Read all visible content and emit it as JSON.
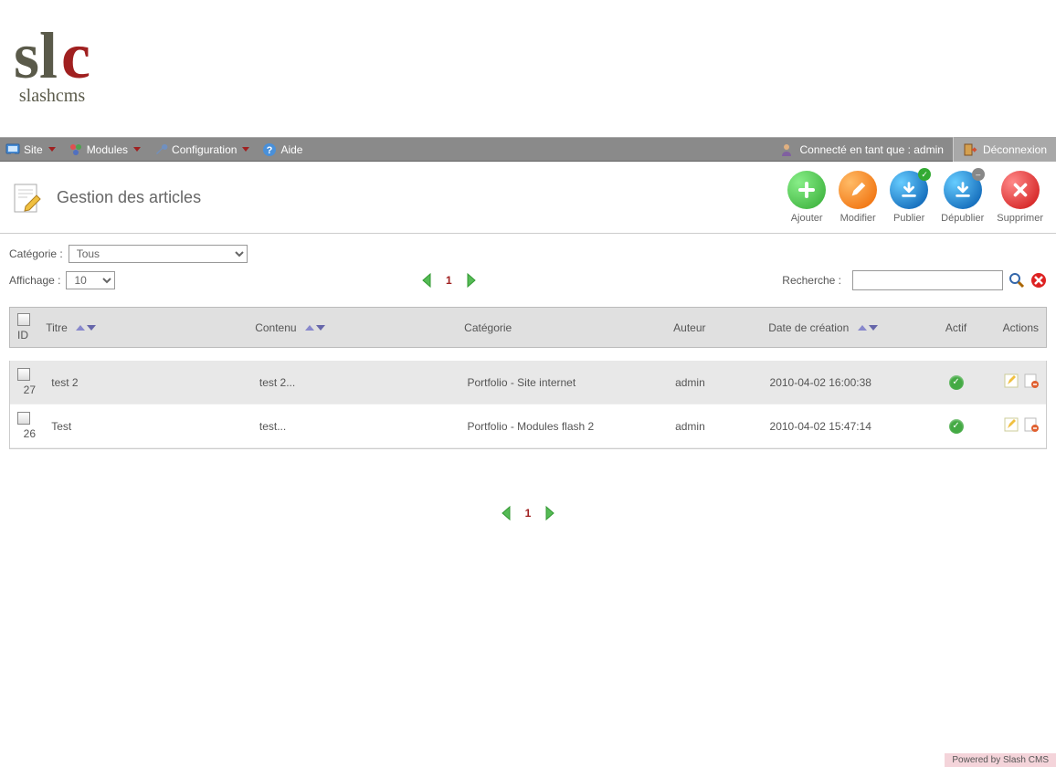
{
  "logo": {
    "subtitle": "slashcms"
  },
  "menu": {
    "site": "Site",
    "modules": "Modules",
    "configuration": "Configuration",
    "aide": "Aide"
  },
  "user": {
    "status_prefix": "Connecté en tant que : ",
    "username": "admin",
    "logout": "Déconnexion"
  },
  "page": {
    "title": "Gestion des articles"
  },
  "actions": {
    "ajouter": "Ajouter",
    "modifier": "Modifier",
    "publier": "Publier",
    "depublier": "Dépublier",
    "supprimer": "Supprimer"
  },
  "filters": {
    "categorie_label": "Catégorie :",
    "categorie_value": "Tous",
    "affichage_label": "Affichage :",
    "affichage_value": "10",
    "recherche_label": "Recherche :"
  },
  "pager": {
    "current": "1"
  },
  "table": {
    "headers": {
      "id": "ID",
      "titre": "Titre",
      "contenu": "Contenu",
      "categorie": "Catégorie",
      "auteur": "Auteur",
      "date": "Date de création",
      "actif": "Actif",
      "actions": "Actions"
    },
    "rows": [
      {
        "id": "27",
        "titre": "test 2",
        "contenu": "test 2...",
        "categorie": "Portfolio - Site internet",
        "auteur": "admin",
        "date": "2010-04-02 16:00:38",
        "actif": true
      },
      {
        "id": "26",
        "titre": "Test",
        "contenu": "test...",
        "categorie": "Portfolio - Modules flash 2",
        "auteur": "admin",
        "date": "2010-04-02 15:47:14",
        "actif": true
      }
    ]
  },
  "footer": {
    "text": "Powered by Slash CMS"
  }
}
